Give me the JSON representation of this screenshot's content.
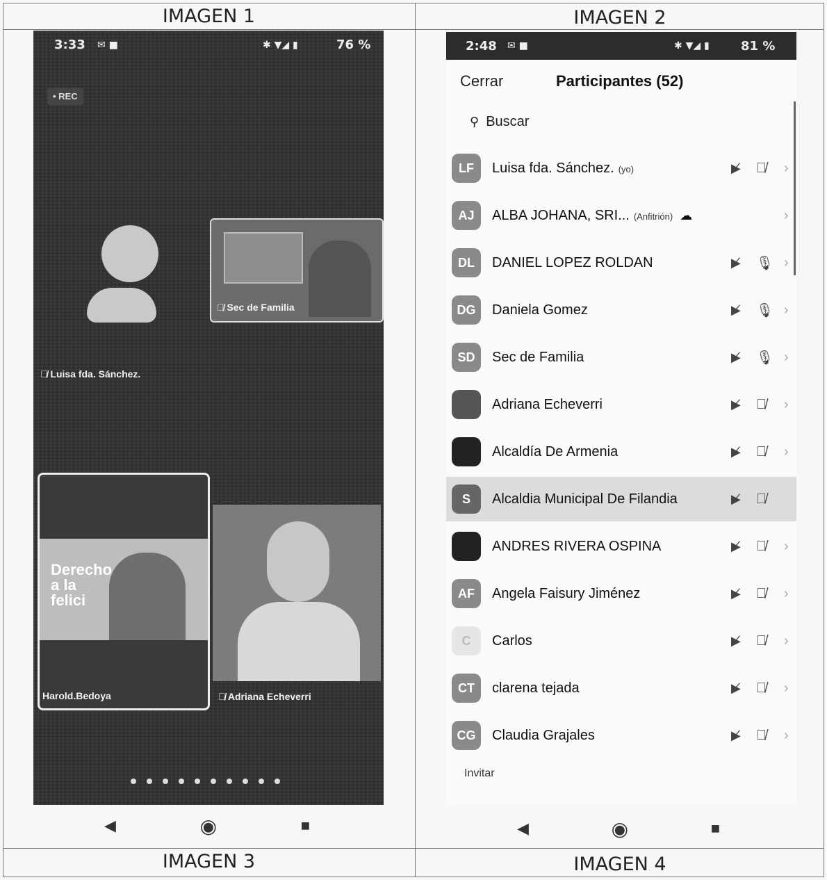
{
  "captions": {
    "img1": "IMAGEN 1",
    "img2": "IMAGEN 2",
    "img3": "IMAGEN 3",
    "img4": "IMAGEN 4"
  },
  "left_phone": {
    "status": {
      "time": "3:33",
      "battery": "76 %"
    },
    "rec": "• REC",
    "tiles": [
      {
        "label": "Luisa fda. Sánchez."
      },
      {
        "label": "Sec de Familia"
      },
      {
        "label": "Harold.Bedoya"
      },
      {
        "label": "Adriana Echeverri"
      }
    ],
    "banner_text": "Derecho a la felici"
  },
  "right_phone": {
    "status": {
      "time": "2:48",
      "battery": "81 %"
    },
    "close_label": "Cerrar",
    "title": "Participantes (52)",
    "search_placeholder": "Buscar",
    "participants": [
      {
        "initials": "LF",
        "name": "Luisa fda. Sánchez.",
        "tag": "(yo)"
      },
      {
        "initials": "AJ",
        "name": "ALBA JOHANA, SRI...",
        "tag": "(Anfitrión)"
      },
      {
        "initials": "DL",
        "name": "DANIEL LOPEZ ROLDAN",
        "tag": ""
      },
      {
        "initials": "DG",
        "name": "Daniela Gomez",
        "tag": ""
      },
      {
        "initials": "SD",
        "name": "Sec de Familia",
        "tag": ""
      },
      {
        "initials": "",
        "name": "Adriana Echeverri",
        "tag": ""
      },
      {
        "initials": "",
        "name": "Alcaldía De Armenia",
        "tag": ""
      },
      {
        "initials": "S",
        "name": "Alcaldia Municipal De Filandia",
        "tag": ""
      },
      {
        "initials": "",
        "name": "ANDRES RIVERA OSPINA",
        "tag": ""
      },
      {
        "initials": "AF",
        "name": "Angela Faisury Jiménez",
        "tag": ""
      },
      {
        "initials": "C",
        "name": "Carlos",
        "tag": ""
      },
      {
        "initials": "CT",
        "name": "clarena tejada",
        "tag": ""
      },
      {
        "initials": "CG",
        "name": "Claudia Grajales",
        "tag": ""
      }
    ],
    "invite_label": "Invitar"
  }
}
